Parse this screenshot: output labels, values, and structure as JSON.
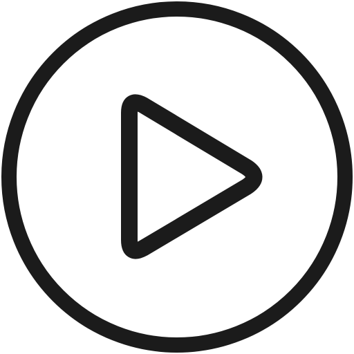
{
  "icon": {
    "name": "play-circle-icon",
    "stroke_color": "#1b1b1b",
    "background_color": "#ffffff"
  }
}
